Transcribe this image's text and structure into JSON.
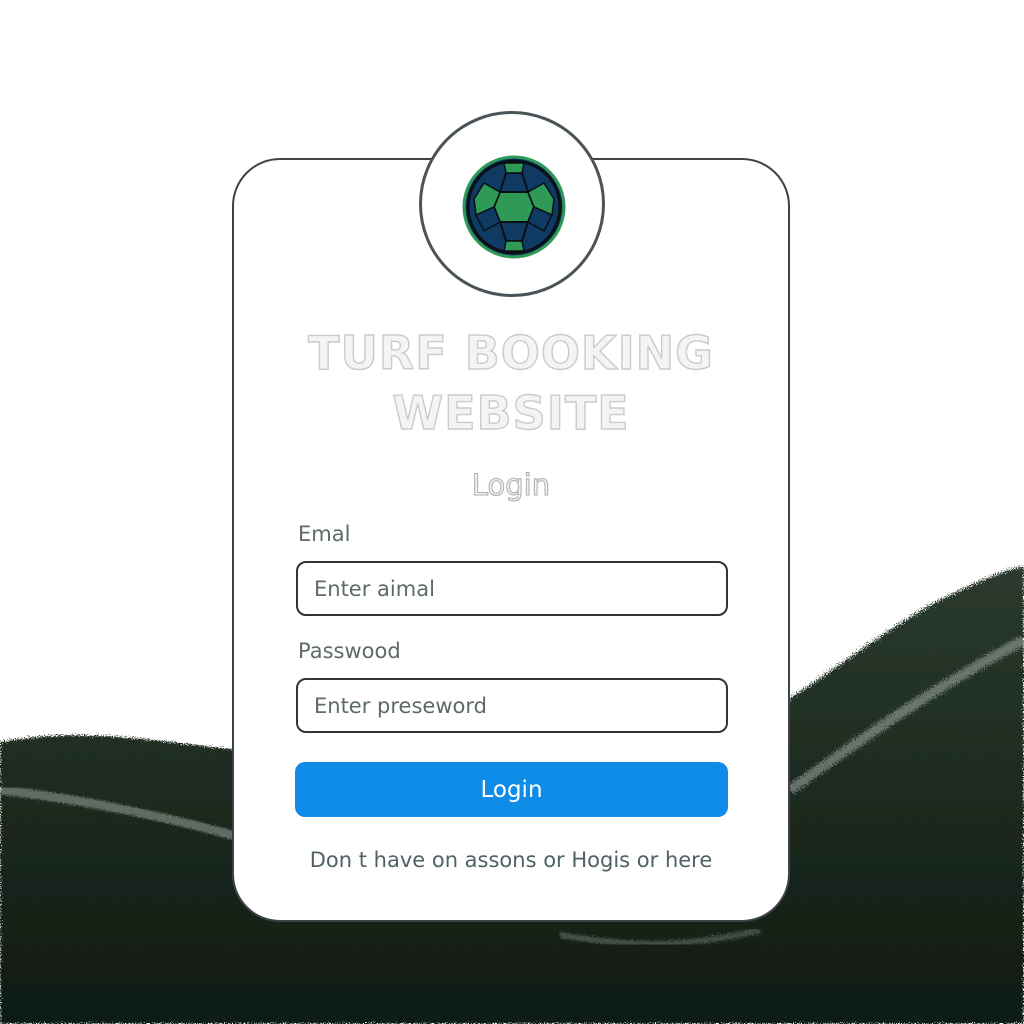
{
  "brand": {
    "title_line1": "TURF BOOKING",
    "title_line2": "WEBSITE",
    "logo_icon": "soccer-ball-icon",
    "logo_colors": [
      "#2f9a56",
      "#0e3a63"
    ]
  },
  "form": {
    "heading": "Login",
    "email_label": "Emal",
    "email_placeholder": "Enter aimal",
    "email_value": "",
    "password_label": "Passwood",
    "password_placeholder": "Enter preseword",
    "password_value": "",
    "submit_label": "Login"
  },
  "footer": {
    "signup_text": "Don t have on assons or Hogis or here"
  },
  "colors": {
    "accent": "#0f8ce8",
    "field_green": "#1c2b1f"
  }
}
